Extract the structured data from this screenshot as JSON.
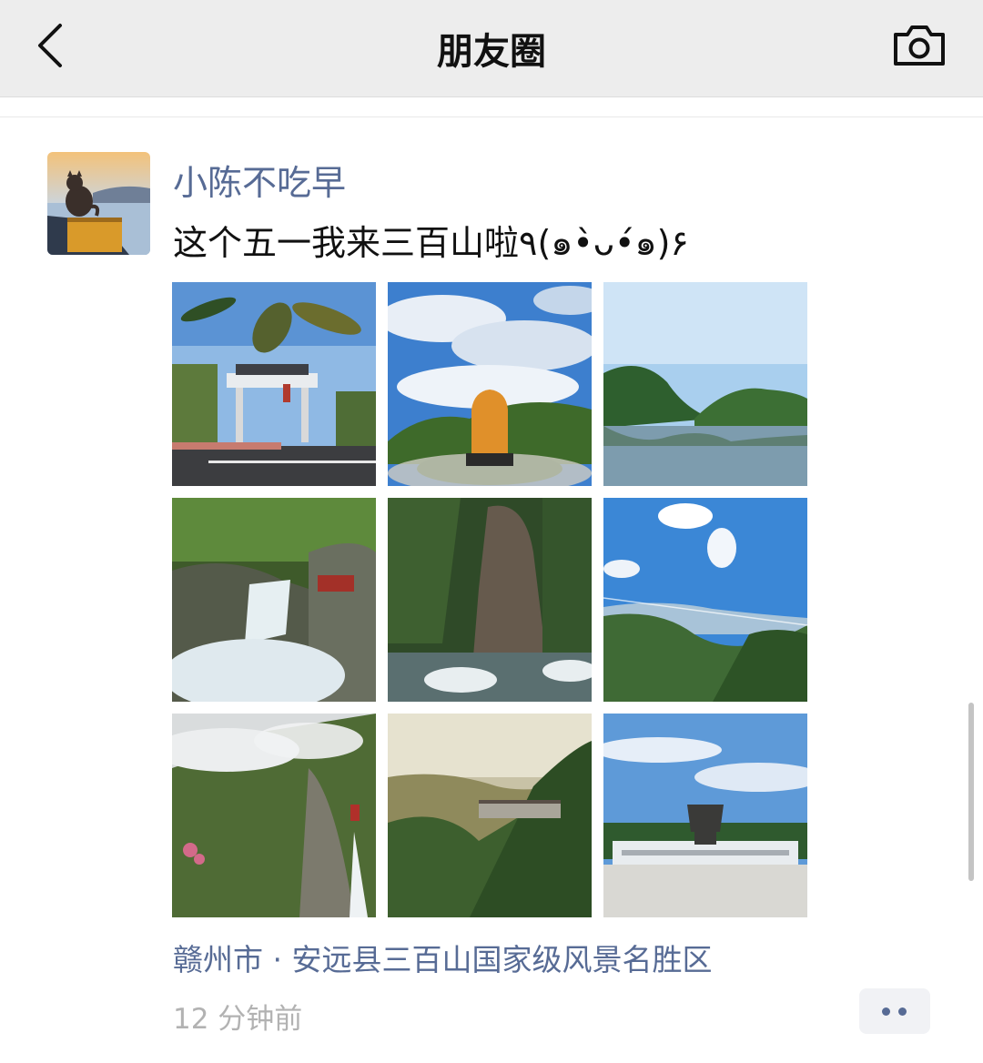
{
  "header": {
    "title": "朋友圈",
    "back_icon": "chevron-left-icon",
    "camera_icon": "camera-icon"
  },
  "post": {
    "username": "小陈不吃早",
    "text": "这个五一我来三百山啦٩(๑•̀ᴗ•́๑)۶",
    "location": "赣州市 · 安远县三百山国家级风景名胜区",
    "time": "12 分钟前",
    "photos": [
      "scenic-gate-photo",
      "stone-monument-photo",
      "lake-mountain-photo",
      "waterfall-photo",
      "gorge-stream-photo",
      "blue-sky-valley-photo",
      "misty-cliff-photo",
      "cliff-walkway-photo",
      "bronze-ding-plaza-photo"
    ]
  },
  "colors": {
    "link": "#576b95",
    "nav_bg": "#ededed",
    "time": "#b2b2b2"
  }
}
